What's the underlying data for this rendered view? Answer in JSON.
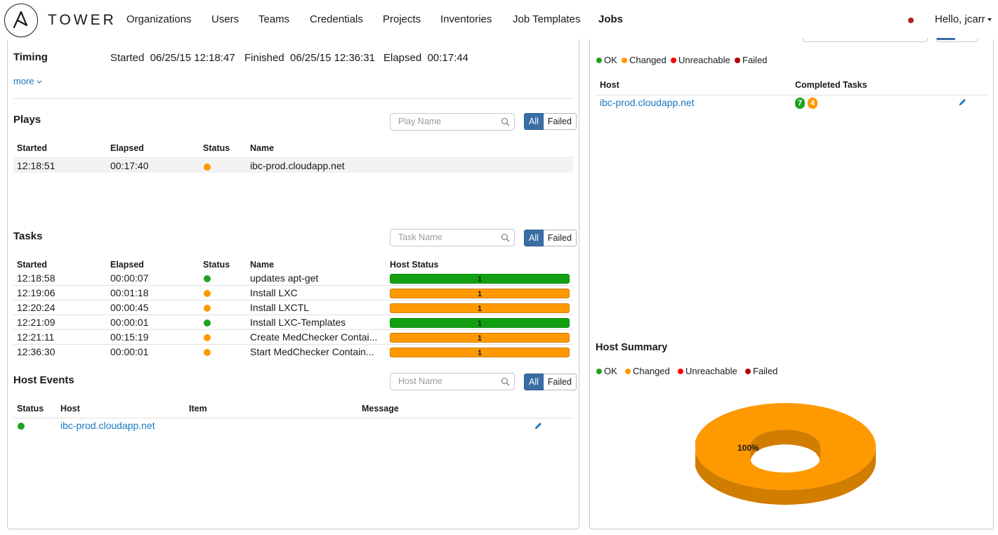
{
  "brand": {
    "name": "TOWER"
  },
  "nav": {
    "links": [
      "Organizations",
      "Users",
      "Teams",
      "Credentials",
      "Projects",
      "Inventories",
      "Job Templates",
      "Jobs"
    ],
    "user_greeting": "Hello, jcarr"
  },
  "timing": {
    "title": "Timing",
    "started_label": "Started",
    "started_value": "06/25/15 12:18:47",
    "finished_label": "Finished",
    "finished_value": "06/25/15 12:36:31",
    "elapsed_label": "Elapsed",
    "elapsed_value": "00:17:44",
    "more_label": "more"
  },
  "plays": {
    "title": "Plays",
    "search_placeholder": "Play Name",
    "filter_all": "All",
    "filter_failed": "Failed",
    "columns": [
      "Started",
      "Elapsed",
      "Status",
      "Name"
    ],
    "rows": [
      {
        "started": "12:18:51",
        "elapsed": "00:17:40",
        "status": "changed",
        "name": "ibc-prod.cloudapp.net"
      }
    ]
  },
  "tasks": {
    "title": "Tasks",
    "search_placeholder": "Task Name",
    "filter_all": "All",
    "filter_failed": "Failed",
    "columns": [
      "Started",
      "Elapsed",
      "Status",
      "Name",
      "Host Status"
    ],
    "rows": [
      {
        "started": "12:18:58",
        "elapsed": "00:00:07",
        "status": "ok",
        "name": "updates apt-get",
        "host_count": "1"
      },
      {
        "started": "12:19:06",
        "elapsed": "00:01:18",
        "status": "changed",
        "name": "Install LXC",
        "host_count": "1"
      },
      {
        "started": "12:20:24",
        "elapsed": "00:00:45",
        "status": "changed",
        "name": "Install LXCTL",
        "host_count": "1"
      },
      {
        "started": "12:21:09",
        "elapsed": "00:00:01",
        "status": "ok",
        "name": "Install LXC-Templates",
        "host_count": "1"
      },
      {
        "started": "12:21:11",
        "elapsed": "00:15:19",
        "status": "changed",
        "name": "Create MedChecker Contai...",
        "host_count": "1"
      },
      {
        "started": "12:36:30",
        "elapsed": "00:00:01",
        "status": "changed",
        "name": "Start MedChecker Contain...",
        "host_count": "1"
      }
    ]
  },
  "host_events": {
    "title": "Host Events",
    "search_placeholder": "Host Name",
    "filter_all": "All",
    "filter_failed": "Failed",
    "columns": [
      "Status",
      "Host",
      "Item",
      "Message"
    ],
    "rows": [
      {
        "status": "ok",
        "host": "ibc-prod.cloudapp.net",
        "item": "",
        "message": ""
      }
    ]
  },
  "legend": {
    "ok": "OK",
    "changed": "Changed",
    "unreachable": "Unreachable",
    "failed": "Failed"
  },
  "hosts": {
    "columns": [
      "Host",
      "Completed Tasks"
    ],
    "rows": [
      {
        "host": "ibc-prod.cloudapp.net",
        "ok_count": "7",
        "changed_count": "4"
      }
    ]
  },
  "host_summary": {
    "title": "Host Summary"
  },
  "chart_data": {
    "type": "pie",
    "variant": "donut-3d",
    "categories": [
      "OK",
      "Changed",
      "Unreachable",
      "Failed"
    ],
    "values": [
      0,
      100,
      0,
      0
    ],
    "labels": [
      "100%"
    ],
    "colors": {
      "OK": "#1fa11f",
      "Changed": "#ff9900",
      "Unreachable": "#ff0000",
      "Failed": "#b00000"
    }
  },
  "colors": {
    "link": "#1778c3",
    "ok": "#1fa11f",
    "changed": "#ff9900",
    "unreachable": "#ff0000",
    "failed": "#b00000",
    "active_button": "#3a6ea5"
  }
}
